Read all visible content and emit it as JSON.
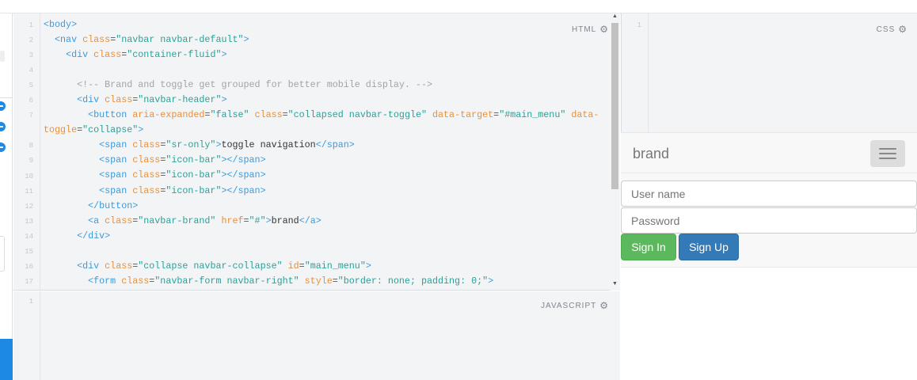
{
  "panes": {
    "html_label": "HTML",
    "css_label": "CSS",
    "js_label": "JAVASCRIPT"
  },
  "html_line_numbers": [
    "1",
    "2",
    "3",
    "4",
    "5",
    "6",
    "7",
    "",
    "8",
    "9",
    "10",
    "11",
    "12",
    "13",
    "14",
    "15",
    "16",
    "17"
  ],
  "html_code": [
    [
      [
        "tag",
        "<body>"
      ]
    ],
    [
      [
        "txt",
        "  "
      ],
      [
        "tag",
        "<nav"
      ],
      [
        "txt",
        " "
      ],
      [
        "attr",
        "class"
      ],
      [
        "punc",
        "="
      ],
      [
        "str",
        "\"navbar navbar-default\""
      ],
      [
        "tag",
        ">"
      ]
    ],
    [
      [
        "txt",
        "    "
      ],
      [
        "tag",
        "<div"
      ],
      [
        "txt",
        " "
      ],
      [
        "attr",
        "class"
      ],
      [
        "punc",
        "="
      ],
      [
        "str",
        "\"container-fluid\""
      ],
      [
        "tag",
        ">"
      ]
    ],
    [],
    [
      [
        "txt",
        "      "
      ],
      [
        "com",
        "<!-- Brand and toggle get grouped for better mobile display. -->"
      ]
    ],
    [
      [
        "txt",
        "      "
      ],
      [
        "tag",
        "<div"
      ],
      [
        "txt",
        " "
      ],
      [
        "attr",
        "class"
      ],
      [
        "punc",
        "="
      ],
      [
        "str",
        "\"navbar-header\""
      ],
      [
        "tag",
        ">"
      ]
    ],
    [
      [
        "txt",
        "        "
      ],
      [
        "tag",
        "<button"
      ],
      [
        "txt",
        " "
      ],
      [
        "attr",
        "aria-expanded"
      ],
      [
        "punc",
        "="
      ],
      [
        "str",
        "\"false\""
      ],
      [
        "txt",
        " "
      ],
      [
        "attr",
        "class"
      ],
      [
        "punc",
        "="
      ],
      [
        "str",
        "\"collapsed navbar-toggle\""
      ],
      [
        "txt",
        " "
      ],
      [
        "attr",
        "data-target"
      ],
      [
        "punc",
        "="
      ],
      [
        "str",
        "\"#main_menu\""
      ],
      [
        "txt",
        " "
      ],
      [
        "attr",
        "data-toggle"
      ],
      [
        "punc",
        "="
      ],
      [
        "str",
        "\"collapse\""
      ],
      [
        "tag",
        ">"
      ]
    ],
    [
      [
        "txt",
        "          "
      ],
      [
        "tag",
        "<span"
      ],
      [
        "txt",
        " "
      ],
      [
        "attr",
        "class"
      ],
      [
        "punc",
        "="
      ],
      [
        "str",
        "\"sr-only\""
      ],
      [
        "tag",
        ">"
      ],
      [
        "txt",
        "toggle navigation"
      ],
      [
        "tag",
        "</span>"
      ]
    ],
    [
      [
        "txt",
        "          "
      ],
      [
        "tag",
        "<span"
      ],
      [
        "txt",
        " "
      ],
      [
        "attr",
        "class"
      ],
      [
        "punc",
        "="
      ],
      [
        "str",
        "\"icon-bar\""
      ],
      [
        "tag",
        ">"
      ],
      [
        "tag",
        "</span>"
      ]
    ],
    [
      [
        "txt",
        "          "
      ],
      [
        "tag",
        "<span"
      ],
      [
        "txt",
        " "
      ],
      [
        "attr",
        "class"
      ],
      [
        "punc",
        "="
      ],
      [
        "str",
        "\"icon-bar\""
      ],
      [
        "tag",
        ">"
      ],
      [
        "tag",
        "</span>"
      ]
    ],
    [
      [
        "txt",
        "          "
      ],
      [
        "tag",
        "<span"
      ],
      [
        "txt",
        " "
      ],
      [
        "attr",
        "class"
      ],
      [
        "punc",
        "="
      ],
      [
        "str",
        "\"icon-bar\""
      ],
      [
        "tag",
        ">"
      ],
      [
        "tag",
        "</span>"
      ]
    ],
    [
      [
        "txt",
        "        "
      ],
      [
        "tag",
        "</button>"
      ]
    ],
    [
      [
        "txt",
        "        "
      ],
      [
        "tag",
        "<a"
      ],
      [
        "txt",
        " "
      ],
      [
        "attr",
        "class"
      ],
      [
        "punc",
        "="
      ],
      [
        "str",
        "\"navbar-brand\""
      ],
      [
        "txt",
        " "
      ],
      [
        "attr",
        "href"
      ],
      [
        "punc",
        "="
      ],
      [
        "str",
        "\"#\""
      ],
      [
        "tag",
        ">"
      ],
      [
        "txt",
        "brand"
      ],
      [
        "tag",
        "</a>"
      ]
    ],
    [
      [
        "txt",
        "      "
      ],
      [
        "tag",
        "</div>"
      ]
    ],
    [],
    [
      [
        "txt",
        "      "
      ],
      [
        "tag",
        "<div"
      ],
      [
        "txt",
        " "
      ],
      [
        "attr",
        "class"
      ],
      [
        "punc",
        "="
      ],
      [
        "str",
        "\"collapse navbar-collapse\""
      ],
      [
        "txt",
        " "
      ],
      [
        "attr",
        "id"
      ],
      [
        "punc",
        "="
      ],
      [
        "str",
        "\"main_menu\""
      ],
      [
        "tag",
        ">"
      ]
    ],
    [
      [
        "txt",
        "        "
      ],
      [
        "tag",
        "<form"
      ],
      [
        "txt",
        " "
      ],
      [
        "attr",
        "class"
      ],
      [
        "punc",
        "="
      ],
      [
        "str",
        "\"navbar-form navbar-right\""
      ],
      [
        "txt",
        " "
      ],
      [
        "attr",
        "style"
      ],
      [
        "punc",
        "="
      ],
      [
        "str",
        "\"border: none; padding: 0;\""
      ],
      [
        "tag",
        ">"
      ]
    ]
  ],
  "css_line_numbers": [
    "1"
  ],
  "js_line_numbers": [
    "1"
  ],
  "preview": {
    "brand": "brand",
    "username_placeholder": "User name",
    "password_placeholder": "Password",
    "sign_in": "Sign In",
    "sign_up": "Sign Up",
    "colors": {
      "sign_in": "#5cb85c",
      "sign_up": "#337ab7"
    }
  }
}
